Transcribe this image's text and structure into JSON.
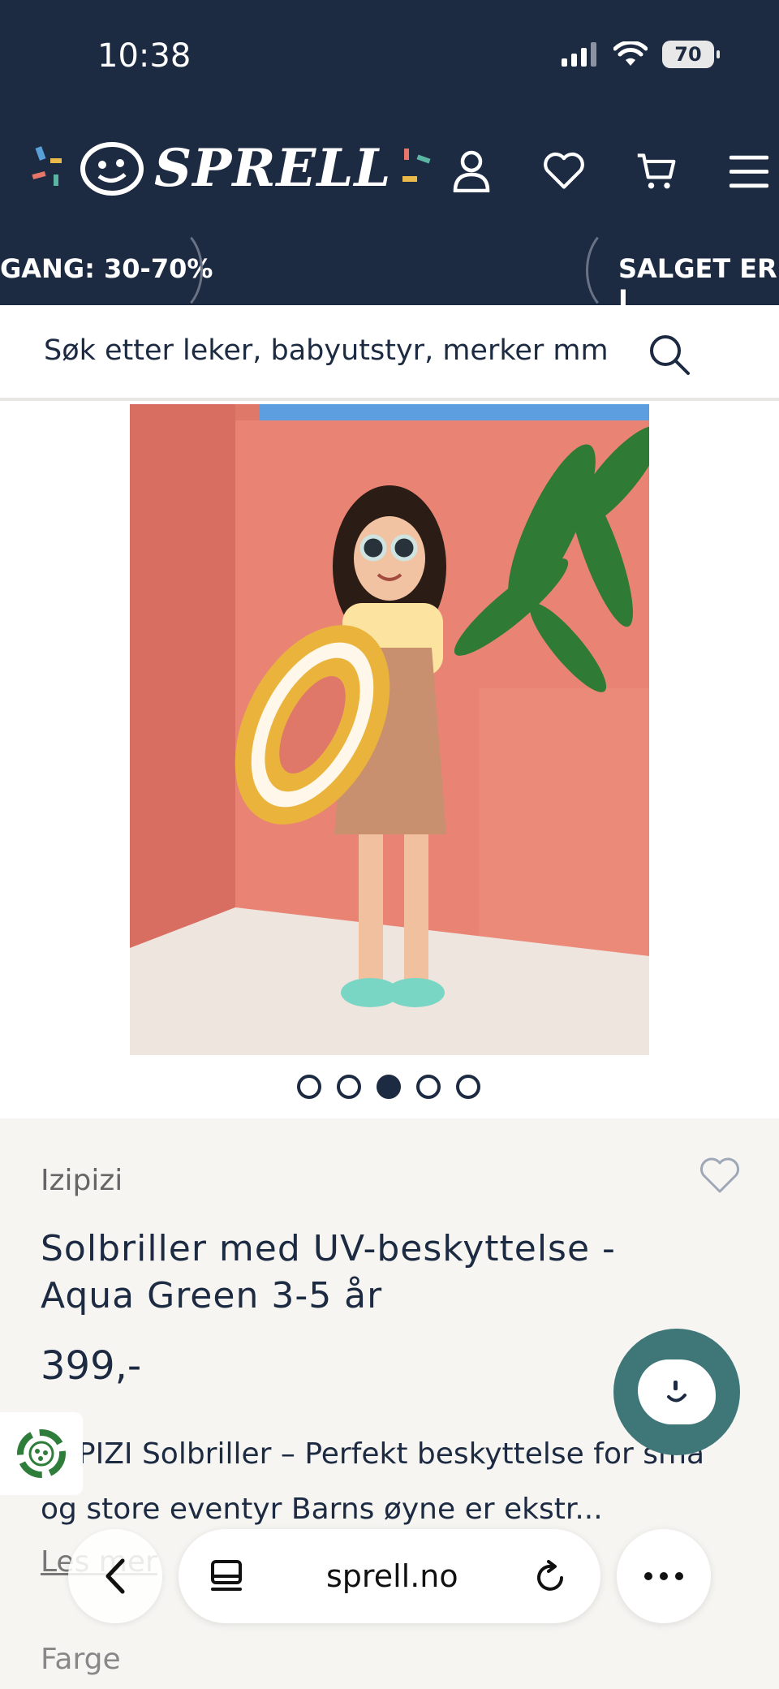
{
  "status_bar": {
    "time": "10:38",
    "battery": "70"
  },
  "header": {
    "logo": "SPRELL",
    "icons": [
      "user-icon",
      "heart-icon",
      "cart-icon",
      "menu-icon"
    ]
  },
  "promo": {
    "left_text": "GANG: 30-70%",
    "right_text": "SALGET ER I"
  },
  "search": {
    "placeholder": "Søk etter leker, babyutstyr, merker mm"
  },
  "gallery": {
    "total": 5,
    "active_index": 2
  },
  "product": {
    "brand": "Izipizi",
    "title": "Solbriller med UV-beskyttelse - Aqua Green 3-5 år",
    "price": "399,-",
    "description": "IZIPIZI Solbriller – Perfekt beskyttelse for små og store eventyr Barns øyne er ekstr...",
    "read_more": "Les mer",
    "color_label": "Farge"
  },
  "browser": {
    "url": "sprell.no"
  },
  "colors": {
    "navy": "#1c2a42",
    "chat": "#3f7779",
    "panel": "#f6f5f2",
    "eco": "#2e7d3a"
  }
}
